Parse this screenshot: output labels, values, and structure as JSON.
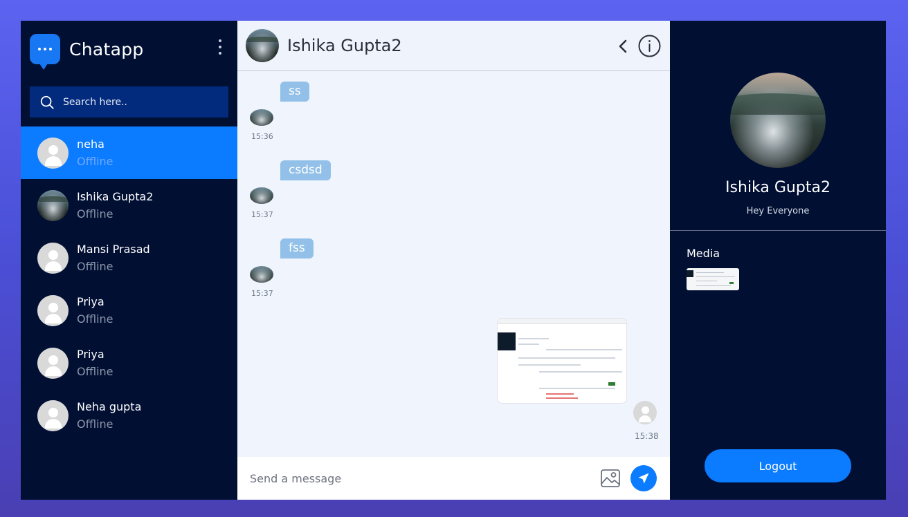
{
  "app": {
    "name": "Chatapp"
  },
  "search": {
    "placeholder": "Search here.."
  },
  "contacts": [
    {
      "name": "neha",
      "status": "Offline",
      "avatar": "default-avatar-icon",
      "active": true
    },
    {
      "name": "Ishika Gupta2",
      "status": "Offline",
      "avatar": "photo",
      "active": false
    },
    {
      "name": "Mansi Prasad",
      "status": "Offline",
      "avatar": "default-avatar-icon",
      "active": false
    },
    {
      "name": "Priya",
      "status": "Offline",
      "avatar": "default-avatar-icon",
      "active": false
    },
    {
      "name": "Priya",
      "status": "Offline",
      "avatar": "default-avatar-icon",
      "active": false
    },
    {
      "name": "Neha gupta",
      "status": "Offline",
      "avatar": "default-avatar-icon",
      "active": false
    }
  ],
  "chat": {
    "title": "Ishika Gupta2",
    "messages": [
      {
        "text": "ss",
        "time": "15:36",
        "direction": "incoming"
      },
      {
        "text": "csdsd",
        "time": "15:37",
        "direction": "incoming"
      },
      {
        "text": "fss",
        "time": "15:37",
        "direction": "incoming"
      },
      {
        "type": "image",
        "time": "15:38",
        "direction": "outgoing"
      }
    ],
    "composer_placeholder": "Send a message",
    "icons": {
      "back": "chevron-left-icon",
      "info": "info-icon",
      "attach": "image-icon",
      "send": "send-icon"
    }
  },
  "profile": {
    "name": "Ishika Gupta2",
    "bio": "Hey Everyone",
    "media_title": "Media",
    "logout_label": "Logout"
  },
  "colors": {
    "accent": "#0b7cff",
    "sidebar_bg": "#010f33",
    "search_bg": "#022a7d",
    "chat_bg": "#eff4fd",
    "bubble": "#92c0e8",
    "page_bg": "#5b63f0"
  }
}
